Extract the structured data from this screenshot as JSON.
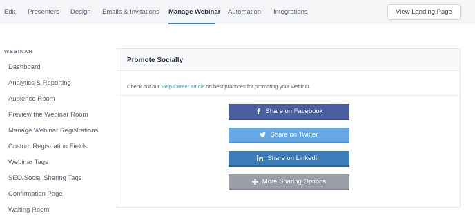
{
  "topnav": {
    "tabs": [
      {
        "label": "Edit"
      },
      {
        "label": "Presenters"
      },
      {
        "label": "Design"
      },
      {
        "label": "Emails & Invitations"
      },
      {
        "label": "Manage Webinar",
        "active": true
      },
      {
        "label": "Automation"
      },
      {
        "label": "Integrations"
      }
    ],
    "landing_button": "View Landing Page"
  },
  "sidebar": {
    "heading": "WEBINAR",
    "items": [
      {
        "label": "Dashboard"
      },
      {
        "label": "Analytics & Reporting"
      },
      {
        "label": "Audience Room"
      },
      {
        "label": "Preview the Webinar Room"
      },
      {
        "label": "Manage Webinar Registrations"
      },
      {
        "label": "Custom Registration Fields"
      },
      {
        "label": "Webinar Tags"
      },
      {
        "label": "SEO/Social Sharing Tags"
      },
      {
        "label": "Confirmation Page"
      },
      {
        "label": "Waiting Room"
      }
    ]
  },
  "card": {
    "title": "Promote Socially",
    "desc_before": "Check out our ",
    "desc_link": "Help Center article",
    "desc_after": " on best practices for promoting your webinar.",
    "buttons": [
      {
        "label": "Share on Facebook",
        "icon": "facebook-icon",
        "color": "#4a5fa0"
      },
      {
        "label": "Share on Twitter",
        "icon": "twitter-icon",
        "color": "#64a8e6"
      },
      {
        "label": "Share on LinkedIn",
        "icon": "linkedin-icon",
        "color": "#3a7db8"
      },
      {
        "label": "More Sharing Options",
        "icon": "plus-icon",
        "color": "#9a9ea6"
      }
    ]
  },
  "colors": {
    "accent": "#3b7fd4",
    "link": "#3aa0a8"
  }
}
